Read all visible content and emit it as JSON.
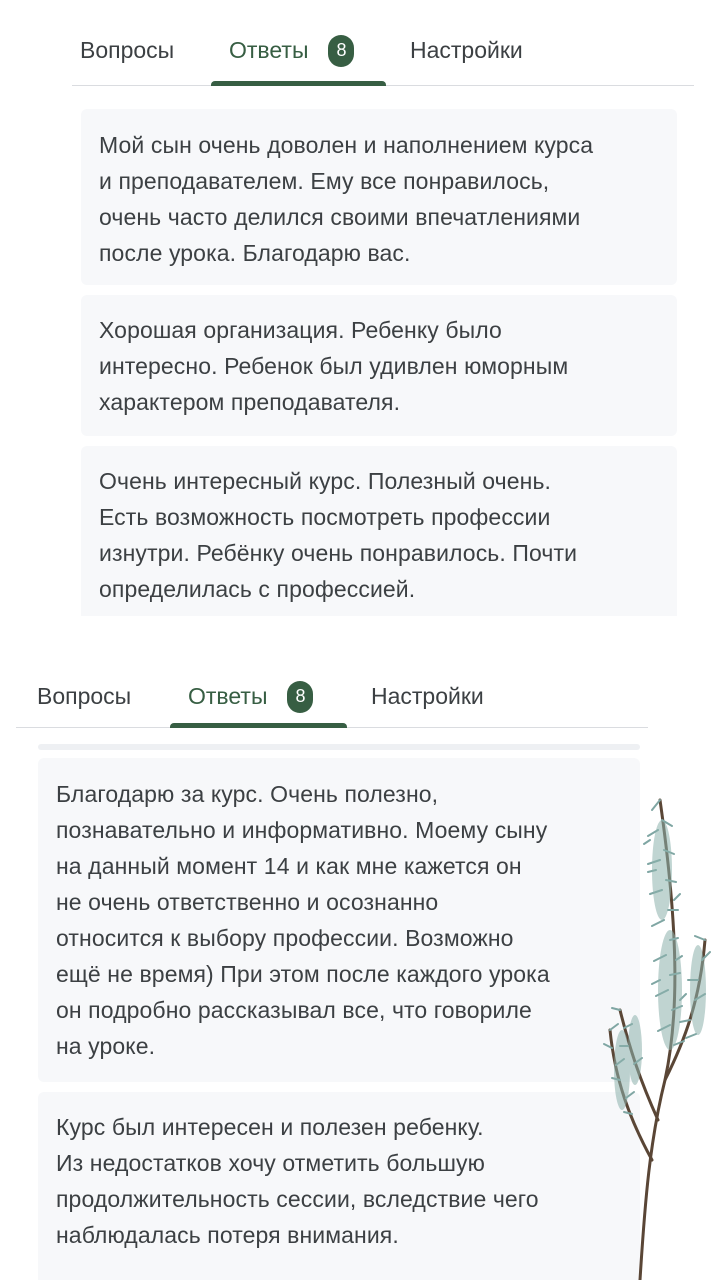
{
  "screens": [
    {
      "tabs": {
        "questions_label": "Вопросы",
        "answers_label": "Ответы",
        "answers_count": "8",
        "settings_label": "Настройки"
      },
      "responses": [
        "Мой сын очень доволен и наполнением курса\nи преподавателем. Ему все понравилось,\nочень часто делился своими впечатлениями\nпосле урока. Благодарю вас.",
        "Хорошая организация. Ребенку было\nинтересно. Ребенок был удивлен юморным\nхарактером преподавателя.",
        "Очень интересный курс. Полезный очень.\nЕсть возможность посмотреть профессии\nизнутри. Ребёнку очень понравилось. Почти\nопределилась с профессией."
      ]
    },
    {
      "tabs": {
        "questions_label": "Вопросы",
        "answers_label": "Ответы",
        "answers_count": "8",
        "settings_label": "Настройки"
      },
      "responses": [
        "Благодарю за курс. Очень полезно,\nпознавательно и информативно. Моему сыну\nна данный момент 14 и как мне кажется он\nне очень ответственно и осознанно\nотносится к выбору профессии. Возможно\nещё не время) При этом после каждого урока\nон подробно рассказывал все, что говориле\nна уроке.",
        "Курс был интересен и полезен ребенку.\nИз недостатков хочу отметить большую\nпродолжительность сессии, вследствие чего\nнаблюдалась потеря внимания."
      ]
    }
  ],
  "colors": {
    "accent": "#375e43",
    "card_bg": "#f7f8fa",
    "text": "#3c4043"
  },
  "decoration": "juniper-branch-illustration"
}
